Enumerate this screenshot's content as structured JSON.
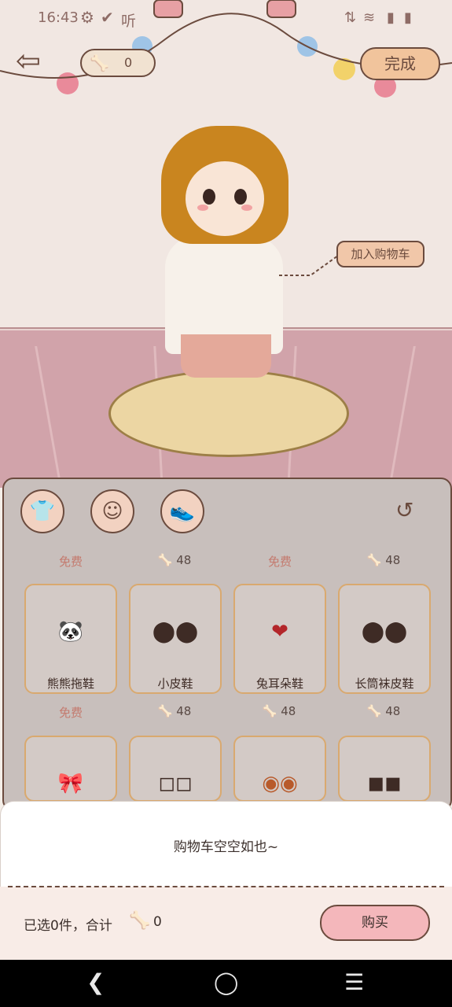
{
  "status_bar": {
    "time": "16:43",
    "left_icons": [
      "gear-icon",
      "check-circle-icon"
    ],
    "listen_text": "听",
    "right_icons": [
      "vibrate-icon",
      "wifi-icon",
      "battery-icon"
    ]
  },
  "header": {
    "coin_value": "0",
    "done_label": "完成",
    "add_to_cart_label": "加入购物车"
  },
  "categories": [
    "shirt-icon",
    "hair-icon",
    "shoe-icon"
  ],
  "items": [
    {
      "price": "免费",
      "free": true,
      "name": "熊熊拖鞋",
      "shoe": "🐼"
    },
    {
      "price": "48",
      "free": false,
      "name": "小皮鞋",
      "shoe": "⬤⬤"
    },
    {
      "price": "免费",
      "free": true,
      "name": "兔耳朵鞋",
      "shoe": "❤"
    },
    {
      "price": "48",
      "free": false,
      "name": "长筒袜皮鞋",
      "shoe": "⬤⬤"
    },
    {
      "price": "免费",
      "free": true,
      "name": "",
      "shoe": "🎀"
    },
    {
      "price": "48",
      "free": false,
      "name": "",
      "shoe": "◻◻"
    },
    {
      "price": "48",
      "free": false,
      "name": "",
      "shoe": "◉◉"
    },
    {
      "price": "48",
      "free": false,
      "name": "",
      "shoe": "◼◼"
    }
  ],
  "cart": {
    "empty_text": "购物车空空如也~",
    "summary_text": "已选0件，合计",
    "total": "0",
    "buy_label": "购买"
  },
  "colors": {
    "accent": "#6b4b3e",
    "buy_button": "#f4b7bb",
    "done_button": "#f1c49c",
    "bone": "#d3a23b"
  }
}
